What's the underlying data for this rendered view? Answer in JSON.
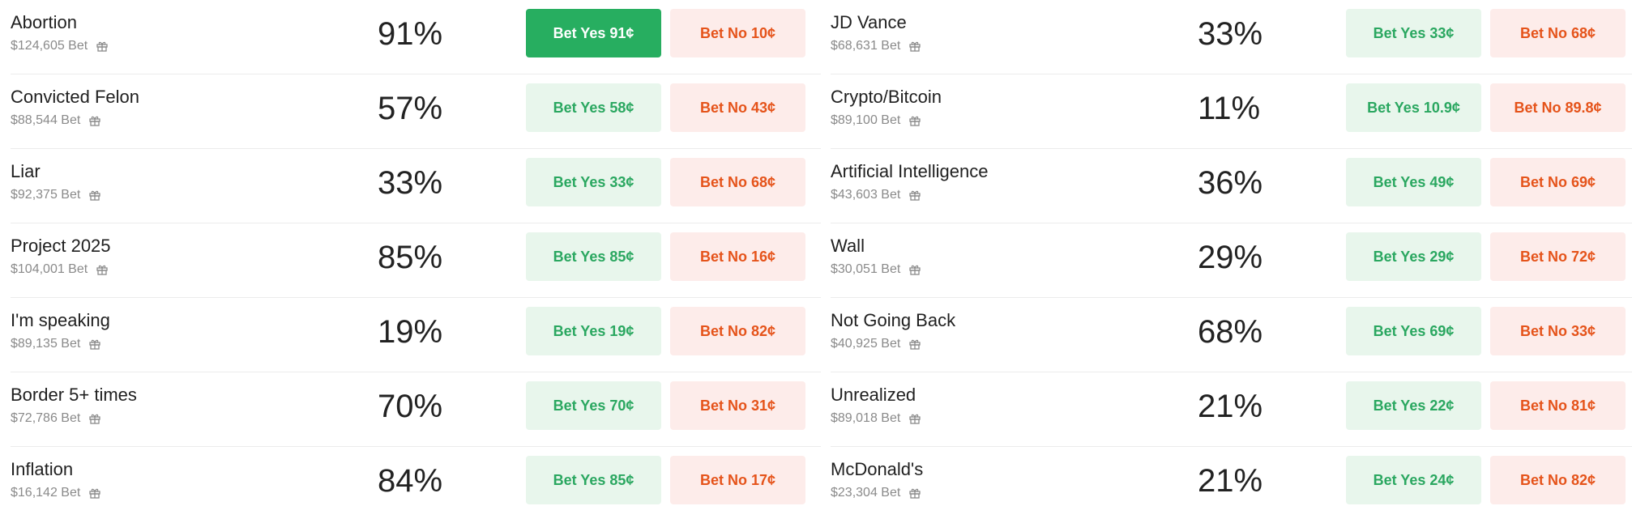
{
  "colors": {
    "yes_bg": "#e8f6ec",
    "yes_text": "#2aa760",
    "yes_active_bg": "#27ae60",
    "no_bg": "#fdecea",
    "no_text": "#e5531a"
  },
  "left": [
    {
      "name": "Abortion",
      "volume": "$124,605 Bet",
      "pct": "91%",
      "yes": "Bet Yes 91¢",
      "no": "Bet No 10¢",
      "yes_active": true
    },
    {
      "name": "Convicted Felon",
      "volume": "$88,544 Bet",
      "pct": "57%",
      "yes": "Bet Yes 58¢",
      "no": "Bet No 43¢"
    },
    {
      "name": "Liar",
      "volume": "$92,375 Bet",
      "pct": "33%",
      "yes": "Bet Yes 33¢",
      "no": "Bet No 68¢"
    },
    {
      "name": "Project 2025",
      "volume": "$104,001 Bet",
      "pct": "85%",
      "yes": "Bet Yes 85¢",
      "no": "Bet No 16¢"
    },
    {
      "name": "I'm speaking",
      "volume": "$89,135 Bet",
      "pct": "19%",
      "yes": "Bet Yes 19¢",
      "no": "Bet No 82¢"
    },
    {
      "name": "Border 5+ times",
      "volume": "$72,786 Bet",
      "pct": "70%",
      "yes": "Bet Yes 70¢",
      "no": "Bet No 31¢"
    },
    {
      "name": "Inflation",
      "volume": "$16,142 Bet",
      "pct": "84%",
      "yes": "Bet Yes 85¢",
      "no": "Bet No 17¢"
    }
  ],
  "right": [
    {
      "name": "JD Vance",
      "volume": "$68,631 Bet",
      "pct": "33%",
      "yes": "Bet Yes 33¢",
      "no": "Bet No 68¢"
    },
    {
      "name": "Crypto/Bitcoin",
      "volume": "$89,100 Bet",
      "pct": "11%",
      "yes": "Bet Yes 10.9¢",
      "no": "Bet No 89.8¢"
    },
    {
      "name": "Artificial Intelligence",
      "volume": "$43,603 Bet",
      "pct": "36%",
      "yes": "Bet Yes 49¢",
      "no": "Bet No 69¢"
    },
    {
      "name": "Wall",
      "volume": "$30,051 Bet",
      "pct": "29%",
      "yes": "Bet Yes 29¢",
      "no": "Bet No 72¢"
    },
    {
      "name": "Not Going Back",
      "volume": "$40,925 Bet",
      "pct": "68%",
      "yes": "Bet Yes 69¢",
      "no": "Bet No 33¢"
    },
    {
      "name": "Unrealized",
      "volume": "$89,018 Bet",
      "pct": "21%",
      "yes": "Bet Yes 22¢",
      "no": "Bet No 81¢"
    },
    {
      "name": "McDonald's",
      "volume": "$23,304 Bet",
      "pct": "21%",
      "yes": "Bet Yes 24¢",
      "no": "Bet No 82¢"
    }
  ]
}
